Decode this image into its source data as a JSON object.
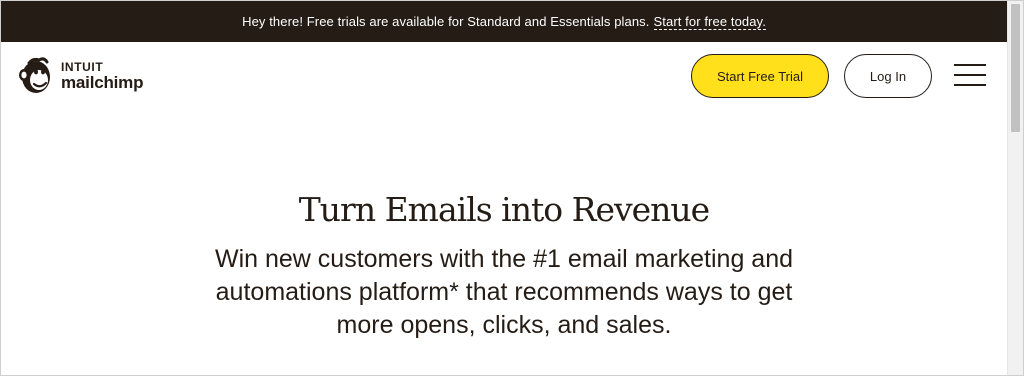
{
  "announcement": {
    "text": "Hey there! Free trials are available for Standard and Essentials plans.",
    "link_text": "Start for free today."
  },
  "logo": {
    "line1": "INTUIT",
    "line2": "mailchimp",
    "icon": "freddie-monkey-icon"
  },
  "nav": {
    "trial_label": "Start Free Trial",
    "login_label": "Log In",
    "menu_icon": "hamburger-menu-icon"
  },
  "hero": {
    "title": "Turn Emails into Revenue",
    "subtitle": "Win new customers with the #1 email marketing and automations platform* that recommends ways to get more opens, clicks, and sales."
  },
  "colors": {
    "announcement_bg": "#241c15",
    "brand_yellow": "#ffe01b",
    "text_dark": "#241c15"
  }
}
